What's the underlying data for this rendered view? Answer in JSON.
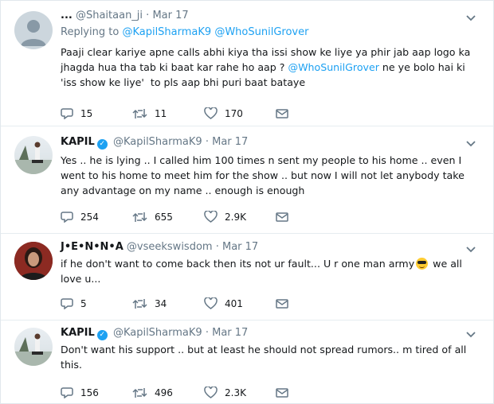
{
  "tweets": [
    {
      "name": "...",
      "handle": "@Shaitaan_ji",
      "time": "Mar 17",
      "replying_prefix": "Replying to",
      "replying_to": [
        "@KapilSharmaK9",
        "@WhoSunilGrover"
      ],
      "text_before": "Paaji clear kariye apne calls abhi kiya tha issi show ke liye ya phir jab aap logo ka jhagda hua tha tab ki baat kar rahe ho aap ? ",
      "text_mention": "@WhoSunilGrover",
      "text_after": " ne ye bolo hai ki 'iss show ke liye'  to pls aap bhi puri baat bataye",
      "replies": "15",
      "retweets": "11",
      "likes": "170"
    },
    {
      "name": "KAPIL",
      "handle": "@KapilSharmaK9",
      "time": "Mar 17",
      "verified": true,
      "text": "Yes .. he is lying .. I called him 100 times n sent my people to his home .. even I went to his home to meet him for the show .. but now I will not let anybody take any advantage on my name .. enough is enough",
      "replies": "254",
      "retweets": "655",
      "likes": "2.9K"
    },
    {
      "name": "J•E•N•N•A",
      "handle": "@vseekswisdom",
      "time": "Mar 17",
      "text_before": "if he don't want to come back then its not ur fault... U r one man army",
      "emoji": "smiling-face-with-sunglasses",
      "text_after": " we all love u...",
      "replies": "5",
      "retweets": "34",
      "likes": "401"
    },
    {
      "name": "KAPIL",
      "handle": "@KapilSharmaK9",
      "time": "Mar 17",
      "verified": true,
      "text": "Don't want his support .. but at least he should not spread rumors.. m tired of all this.",
      "replies": "156",
      "retweets": "496",
      "likes": "2.3K"
    }
  ],
  "separator": "·",
  "colors": {
    "link": "#1da1f2",
    "muted": "#657786",
    "text": "#14171a",
    "verified": "#1da1f2"
  }
}
